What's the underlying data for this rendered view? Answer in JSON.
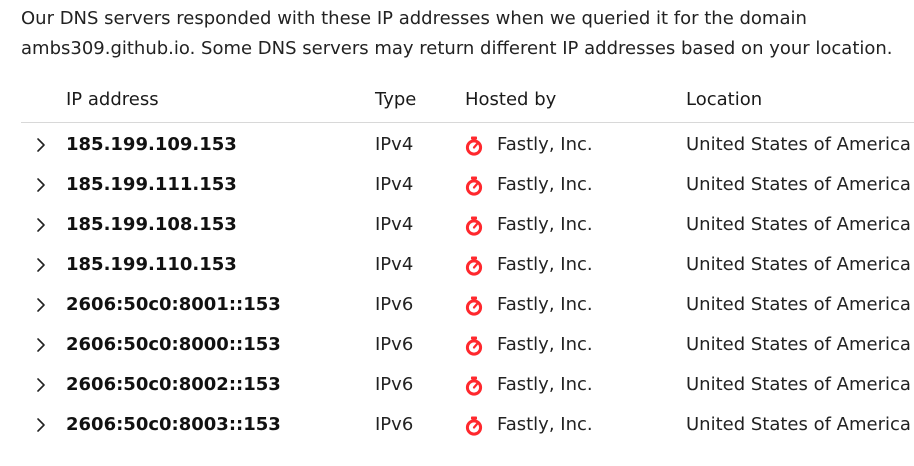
{
  "intro": {
    "line1": "Our DNS servers responded with these IP addresses when we queried it for the domain",
    "line2": "ambs309.github.io. Some DNS servers may return different IP addresses based on your location."
  },
  "table": {
    "headers": {
      "ip": "IP address",
      "type": "Type",
      "hosted_by": "Hosted by",
      "location": "Location"
    },
    "rows": [
      {
        "ip": "185.199.109.153",
        "type": "IPv4",
        "host": "Fastly, Inc.",
        "location": "United States of America"
      },
      {
        "ip": "185.199.111.153",
        "type": "IPv4",
        "host": "Fastly, Inc.",
        "location": "United States of America"
      },
      {
        "ip": "185.199.108.153",
        "type": "IPv4",
        "host": "Fastly, Inc.",
        "location": "United States of America"
      },
      {
        "ip": "185.199.110.153",
        "type": "IPv4",
        "host": "Fastly, Inc.",
        "location": "United States of America"
      },
      {
        "ip": "2606:50c0:8001::153",
        "type": "IPv6",
        "host": "Fastly, Inc.",
        "location": "United States of America"
      },
      {
        "ip": "2606:50c0:8000::153",
        "type": "IPv6",
        "host": "Fastly, Inc.",
        "location": "United States of America"
      },
      {
        "ip": "2606:50c0:8002::153",
        "type": "IPv6",
        "host": "Fastly, Inc.",
        "location": "United States of America"
      },
      {
        "ip": "2606:50c0:8003::153",
        "type": "IPv6",
        "host": "Fastly, Inc.",
        "location": "United States of America"
      }
    ]
  },
  "icons": {
    "row_expand": "chevron-right-icon",
    "host": "fastly-logo-icon"
  },
  "colors": {
    "fastly_red": "#ff282d",
    "divider": "#d8d8d8"
  }
}
